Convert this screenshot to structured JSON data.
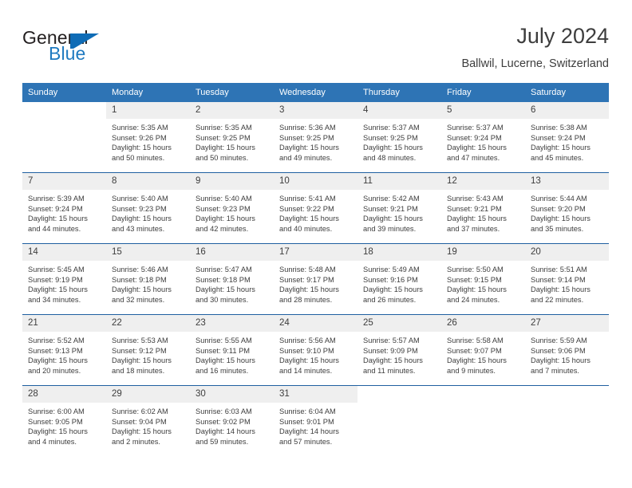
{
  "brand": {
    "word1": "General",
    "word2": "Blue",
    "accent_color": "#1f7ac0",
    "flag_color": "#0f6cb6"
  },
  "header": {
    "title": "July 2024",
    "location": "Ballwil, Lucerne, Switzerland"
  },
  "calendar": {
    "header_bg": "#2e74b5",
    "daynum_bg": "#efefef",
    "row_rule_color": "#1f5fa0",
    "weekdays": [
      "Sunday",
      "Monday",
      "Tuesday",
      "Wednesday",
      "Thursday",
      "Friday",
      "Saturday"
    ],
    "weeks": [
      [
        {
          "day": "",
          "sunrise": "",
          "sunset": "",
          "daylight_line1": "",
          "daylight_line2": ""
        },
        {
          "day": "1",
          "sunrise": "Sunrise: 5:35 AM",
          "sunset": "Sunset: 9:26 PM",
          "daylight_line1": "Daylight: 15 hours",
          "daylight_line2": "and 50 minutes."
        },
        {
          "day": "2",
          "sunrise": "Sunrise: 5:35 AM",
          "sunset": "Sunset: 9:25 PM",
          "daylight_line1": "Daylight: 15 hours",
          "daylight_line2": "and 50 minutes."
        },
        {
          "day": "3",
          "sunrise": "Sunrise: 5:36 AM",
          "sunset": "Sunset: 9:25 PM",
          "daylight_line1": "Daylight: 15 hours",
          "daylight_line2": "and 49 minutes."
        },
        {
          "day": "4",
          "sunrise": "Sunrise: 5:37 AM",
          "sunset": "Sunset: 9:25 PM",
          "daylight_line1": "Daylight: 15 hours",
          "daylight_line2": "and 48 minutes."
        },
        {
          "day": "5",
          "sunrise": "Sunrise: 5:37 AM",
          "sunset": "Sunset: 9:24 PM",
          "daylight_line1": "Daylight: 15 hours",
          "daylight_line2": "and 47 minutes."
        },
        {
          "day": "6",
          "sunrise": "Sunrise: 5:38 AM",
          "sunset": "Sunset: 9:24 PM",
          "daylight_line1": "Daylight: 15 hours",
          "daylight_line2": "and 45 minutes."
        }
      ],
      [
        {
          "day": "7",
          "sunrise": "Sunrise: 5:39 AM",
          "sunset": "Sunset: 9:24 PM",
          "daylight_line1": "Daylight: 15 hours",
          "daylight_line2": "and 44 minutes."
        },
        {
          "day": "8",
          "sunrise": "Sunrise: 5:40 AM",
          "sunset": "Sunset: 9:23 PM",
          "daylight_line1": "Daylight: 15 hours",
          "daylight_line2": "and 43 minutes."
        },
        {
          "day": "9",
          "sunrise": "Sunrise: 5:40 AM",
          "sunset": "Sunset: 9:23 PM",
          "daylight_line1": "Daylight: 15 hours",
          "daylight_line2": "and 42 minutes."
        },
        {
          "day": "10",
          "sunrise": "Sunrise: 5:41 AM",
          "sunset": "Sunset: 9:22 PM",
          "daylight_line1": "Daylight: 15 hours",
          "daylight_line2": "and 40 minutes."
        },
        {
          "day": "11",
          "sunrise": "Sunrise: 5:42 AM",
          "sunset": "Sunset: 9:21 PM",
          "daylight_line1": "Daylight: 15 hours",
          "daylight_line2": "and 39 minutes."
        },
        {
          "day": "12",
          "sunrise": "Sunrise: 5:43 AM",
          "sunset": "Sunset: 9:21 PM",
          "daylight_line1": "Daylight: 15 hours",
          "daylight_line2": "and 37 minutes."
        },
        {
          "day": "13",
          "sunrise": "Sunrise: 5:44 AM",
          "sunset": "Sunset: 9:20 PM",
          "daylight_line1": "Daylight: 15 hours",
          "daylight_line2": "and 35 minutes."
        }
      ],
      [
        {
          "day": "14",
          "sunrise": "Sunrise: 5:45 AM",
          "sunset": "Sunset: 9:19 PM",
          "daylight_line1": "Daylight: 15 hours",
          "daylight_line2": "and 34 minutes."
        },
        {
          "day": "15",
          "sunrise": "Sunrise: 5:46 AM",
          "sunset": "Sunset: 9:18 PM",
          "daylight_line1": "Daylight: 15 hours",
          "daylight_line2": "and 32 minutes."
        },
        {
          "day": "16",
          "sunrise": "Sunrise: 5:47 AM",
          "sunset": "Sunset: 9:18 PM",
          "daylight_line1": "Daylight: 15 hours",
          "daylight_line2": "and 30 minutes."
        },
        {
          "day": "17",
          "sunrise": "Sunrise: 5:48 AM",
          "sunset": "Sunset: 9:17 PM",
          "daylight_line1": "Daylight: 15 hours",
          "daylight_line2": "and 28 minutes."
        },
        {
          "day": "18",
          "sunrise": "Sunrise: 5:49 AM",
          "sunset": "Sunset: 9:16 PM",
          "daylight_line1": "Daylight: 15 hours",
          "daylight_line2": "and 26 minutes."
        },
        {
          "day": "19",
          "sunrise": "Sunrise: 5:50 AM",
          "sunset": "Sunset: 9:15 PM",
          "daylight_line1": "Daylight: 15 hours",
          "daylight_line2": "and 24 minutes."
        },
        {
          "day": "20",
          "sunrise": "Sunrise: 5:51 AM",
          "sunset": "Sunset: 9:14 PM",
          "daylight_line1": "Daylight: 15 hours",
          "daylight_line2": "and 22 minutes."
        }
      ],
      [
        {
          "day": "21",
          "sunrise": "Sunrise: 5:52 AM",
          "sunset": "Sunset: 9:13 PM",
          "daylight_line1": "Daylight: 15 hours",
          "daylight_line2": "and 20 minutes."
        },
        {
          "day": "22",
          "sunrise": "Sunrise: 5:53 AM",
          "sunset": "Sunset: 9:12 PM",
          "daylight_line1": "Daylight: 15 hours",
          "daylight_line2": "and 18 minutes."
        },
        {
          "day": "23",
          "sunrise": "Sunrise: 5:55 AM",
          "sunset": "Sunset: 9:11 PM",
          "daylight_line1": "Daylight: 15 hours",
          "daylight_line2": "and 16 minutes."
        },
        {
          "day": "24",
          "sunrise": "Sunrise: 5:56 AM",
          "sunset": "Sunset: 9:10 PM",
          "daylight_line1": "Daylight: 15 hours",
          "daylight_line2": "and 14 minutes."
        },
        {
          "day": "25",
          "sunrise": "Sunrise: 5:57 AM",
          "sunset": "Sunset: 9:09 PM",
          "daylight_line1": "Daylight: 15 hours",
          "daylight_line2": "and 11 minutes."
        },
        {
          "day": "26",
          "sunrise": "Sunrise: 5:58 AM",
          "sunset": "Sunset: 9:07 PM",
          "daylight_line1": "Daylight: 15 hours",
          "daylight_line2": "and 9 minutes."
        },
        {
          "day": "27",
          "sunrise": "Sunrise: 5:59 AM",
          "sunset": "Sunset: 9:06 PM",
          "daylight_line1": "Daylight: 15 hours",
          "daylight_line2": "and 7 minutes."
        }
      ],
      [
        {
          "day": "28",
          "sunrise": "Sunrise: 6:00 AM",
          "sunset": "Sunset: 9:05 PM",
          "daylight_line1": "Daylight: 15 hours",
          "daylight_line2": "and 4 minutes."
        },
        {
          "day": "29",
          "sunrise": "Sunrise: 6:02 AM",
          "sunset": "Sunset: 9:04 PM",
          "daylight_line1": "Daylight: 15 hours",
          "daylight_line2": "and 2 minutes."
        },
        {
          "day": "30",
          "sunrise": "Sunrise: 6:03 AM",
          "sunset": "Sunset: 9:02 PM",
          "daylight_line1": "Daylight: 14 hours",
          "daylight_line2": "and 59 minutes."
        },
        {
          "day": "31",
          "sunrise": "Sunrise: 6:04 AM",
          "sunset": "Sunset: 9:01 PM",
          "daylight_line1": "Daylight: 14 hours",
          "daylight_line2": "and 57 minutes."
        },
        {
          "day": "",
          "sunrise": "",
          "sunset": "",
          "daylight_line1": "",
          "daylight_line2": ""
        },
        {
          "day": "",
          "sunrise": "",
          "sunset": "",
          "daylight_line1": "",
          "daylight_line2": ""
        },
        {
          "day": "",
          "sunrise": "",
          "sunset": "",
          "daylight_line1": "",
          "daylight_line2": ""
        }
      ]
    ]
  }
}
